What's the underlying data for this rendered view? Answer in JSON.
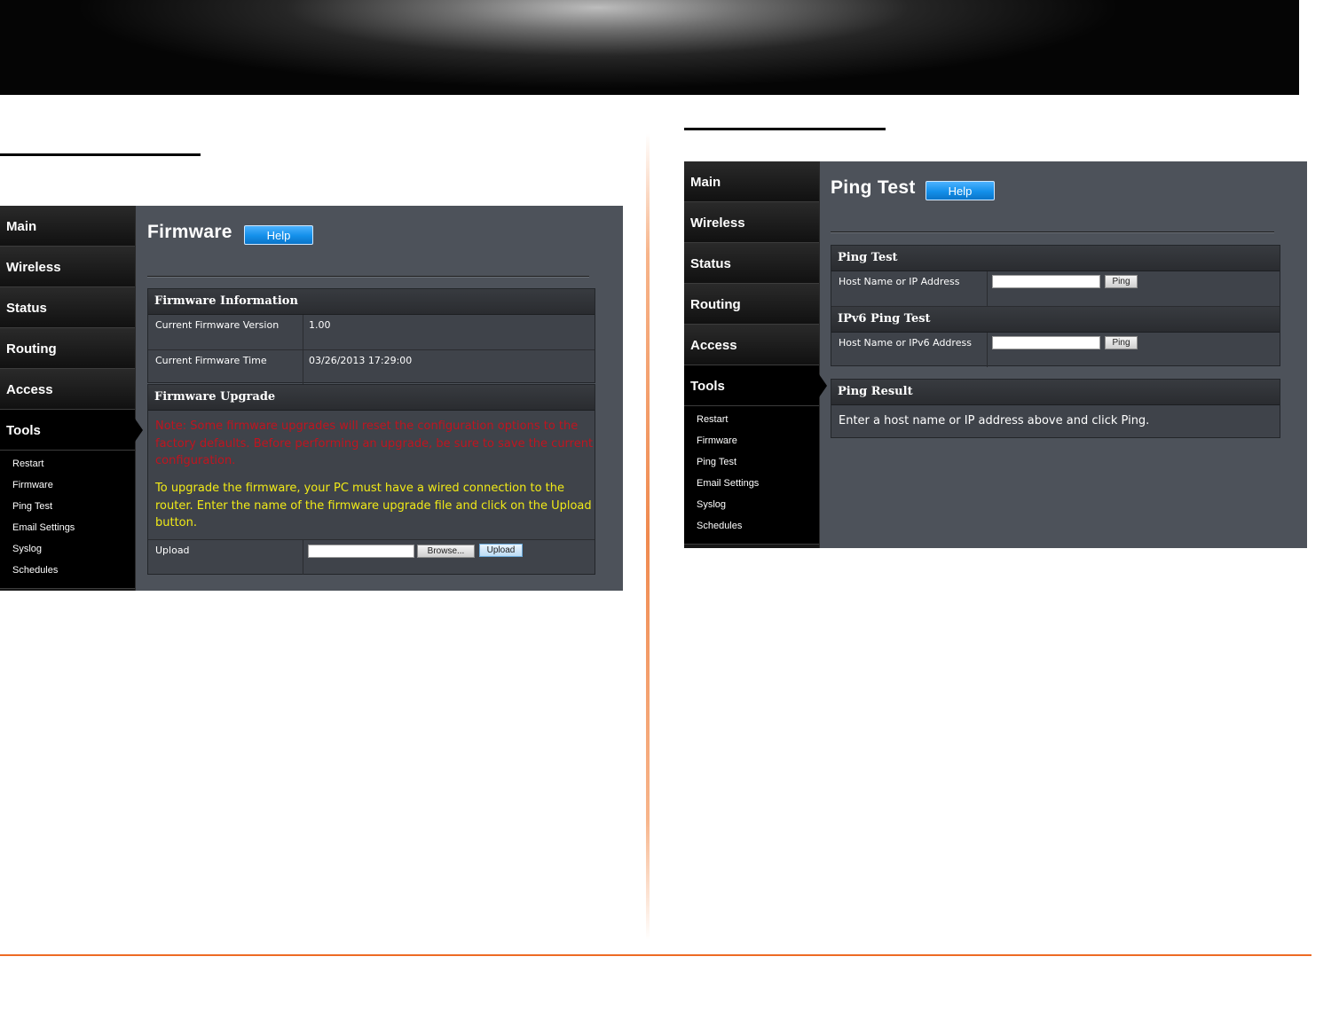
{
  "nav": {
    "main": "Main",
    "wireless": "Wireless",
    "status": "Status",
    "routing": "Routing",
    "access": "Access",
    "tools": "Tools",
    "tools_items": [
      "Restart",
      "Firmware",
      "Ping Test",
      "Email Settings",
      "Syslog",
      "Schedules"
    ]
  },
  "firmware_page": {
    "title": "Firmware",
    "help_label": "Help",
    "info_section": {
      "header": "Firmware Information",
      "version_label": "Current Firmware Version",
      "version_value": "1.00",
      "time_label": "Current Firmware Time",
      "time_value": "03/26/2013 17:29:00"
    },
    "upgrade_section": {
      "header": "Firmware Upgrade",
      "note_red": "Note: Some firmware upgrades will reset the configuration options to the factory defaults. Before performing an upgrade, be sure to save the current configuration.",
      "note_yellow": "To upgrade the firmware, your PC must have a wired connection to the router. Enter the name of the firmware upgrade file and click on the Upload button.",
      "upload_label": "Upload",
      "file_value": "",
      "browse_label": "Browse...",
      "upload_button_label": "Upload"
    }
  },
  "ping_page": {
    "title": "Ping Test",
    "help_label": "Help",
    "ping_section": {
      "header": "Ping Test",
      "host_label": "Host Name or IP Address",
      "host_value": "",
      "ping_label": "Ping"
    },
    "ipv6_section": {
      "header": "IPv6 Ping Test",
      "host_label": "Host Name or IPv6 Address",
      "host_value": "",
      "ping_label": "Ping"
    },
    "result_section": {
      "header": "Ping Result",
      "text": "Enter a host name or IP address above and click Ping."
    }
  },
  "colors": {
    "help_button": "#138fea",
    "panel_bg": "#4d525a",
    "note_red": "#c0141f",
    "note_yellow": "#f1ea17",
    "footer_line": "#ee6b24"
  }
}
